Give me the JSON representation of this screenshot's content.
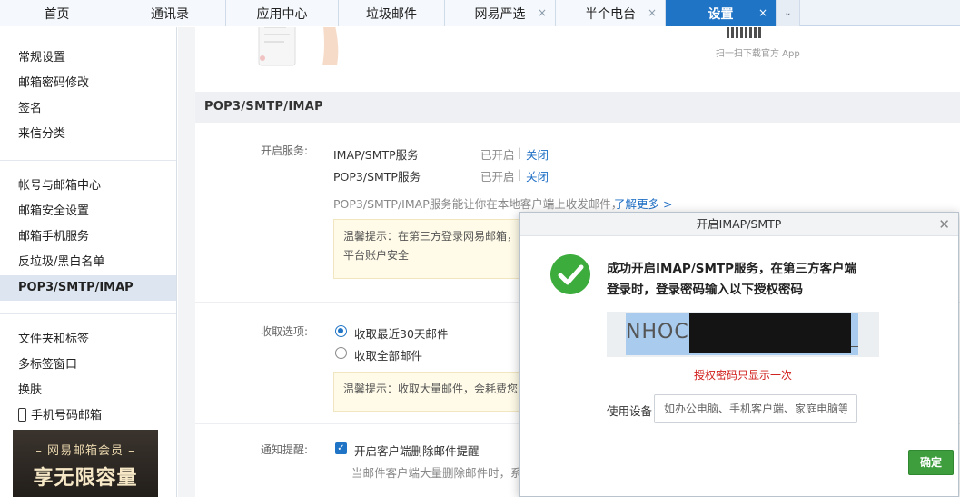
{
  "tabs": [
    {
      "label": "首页",
      "closable": false
    },
    {
      "label": "通讯录",
      "closable": false
    },
    {
      "label": "应用中心",
      "closable": false
    },
    {
      "label": "垃圾邮件",
      "closable": false
    },
    {
      "label": "网易严选",
      "closable": true
    },
    {
      "label": "半个电台",
      "closable": true
    },
    {
      "label": "设置",
      "closable": true,
      "active": true
    }
  ],
  "tab_close_glyph": "×",
  "tab_more_glyph": "⌄",
  "sidebar": {
    "group1": [
      "常规设置",
      "邮箱密码修改",
      "签名",
      "来信分类"
    ],
    "group2": [
      "帐号与邮箱中心",
      "邮箱安全设置",
      "邮箱手机服务",
      "反垃圾/黑白名单",
      "POP3/SMTP/IMAP"
    ],
    "group2_active": "POP3/SMTP/IMAP",
    "group3": [
      "文件夹和标签",
      "多标签窗口",
      "换肤"
    ],
    "phone_mail": "手机号码邮箱",
    "promo_line1": "– 网易邮箱会员 –",
    "promo_line2": "享无限容量"
  },
  "main": {
    "qr_caption": "扫一扫下载官方 App",
    "section_title": "POP3/SMTP/IMAP",
    "service_label": "开启服务:",
    "services": [
      {
        "name": "IMAP/SMTP服务",
        "status": "已开启",
        "sep": "|",
        "action": "关闭"
      },
      {
        "name": "POP3/SMTP服务",
        "status": "已开启",
        "sep": "|",
        "action": "关闭"
      }
    ],
    "service_desc": "POP3/SMTP/IMAP服务能让你在本地客户端上收发邮件，",
    "learn_more": "了解更多 >",
    "hint1_line1": "温馨提示：在第三方登录网易邮箱，",
    "hint1_line2": "平台账户安全",
    "receive_label": "收取选项:",
    "receive_options": [
      {
        "label": "收取最近30天邮件",
        "selected": true
      },
      {
        "label": "收取全部邮件",
        "selected": false
      }
    ],
    "hint2": "温馨提示：收取大量邮件，会耗费您",
    "notify_label": "通知提醒:",
    "notify_option": "开启客户端删除邮件提醒",
    "notify_checked": true,
    "notify_desc": "当邮件客户端大量删除邮件时，系统"
  },
  "dialog": {
    "title": "开启IMAP/SMTP",
    "close_glyph": "✕",
    "message_line1": "成功开启IMAP/SMTP服务，在第三方客户端",
    "message_line2": "登录时，登录密码输入以下授权密码",
    "code_visible": "NHOC",
    "warning": "授权密码只显示一次",
    "device_label": "使用设备",
    "device_placeholder": "如办公电脑、手机客户端、家庭电脑等",
    "device_value": "",
    "ok_label": "确定"
  },
  "colors": {
    "accent": "#1f74c6",
    "success": "#3cac3c",
    "warning": "#d0201e",
    "ok_button": "#3e9e3e"
  },
  "icons": {
    "success": "check-circle-icon",
    "phone": "phone-icon",
    "close": "close-icon",
    "more": "chevron-down-icon"
  }
}
